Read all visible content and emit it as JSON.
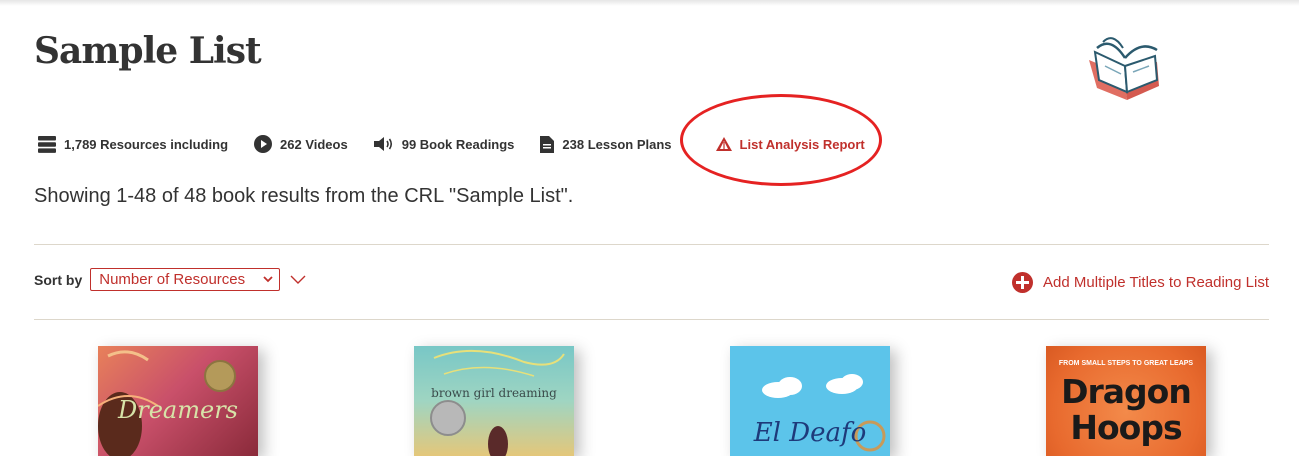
{
  "page": {
    "title": "Sample List",
    "logo_icon": "open-book-logo"
  },
  "stats": [
    {
      "icon": "stack-icon",
      "label": "1,789 Resources including"
    },
    {
      "icon": "play-icon",
      "label": "262 Videos"
    },
    {
      "icon": "speaker-icon",
      "label": "99 Book Readings"
    },
    {
      "icon": "document-icon",
      "label": "238 Lesson Plans"
    }
  ],
  "report_link": {
    "icon": "report-icon",
    "label": "List Analysis Report"
  },
  "results_text": "Showing 1-48 of 48 book results from the CRL \"Sample List\".",
  "sort": {
    "label": "Sort by",
    "selected": "Number of Resources"
  },
  "add_multiple": "Add Multiple Titles to Reading List",
  "books": [
    {
      "title": "Dreamers"
    },
    {
      "title": "brown girl dreaming"
    },
    {
      "title": "El Deafo"
    },
    {
      "kicker": "FROM SMALL STEPS TO GREAT LEAPS",
      "title": "Dragon Hoops"
    }
  ],
  "colors": {
    "accent": "#c0302c",
    "text": "#333333",
    "highlight_ring": "#e52222"
  }
}
